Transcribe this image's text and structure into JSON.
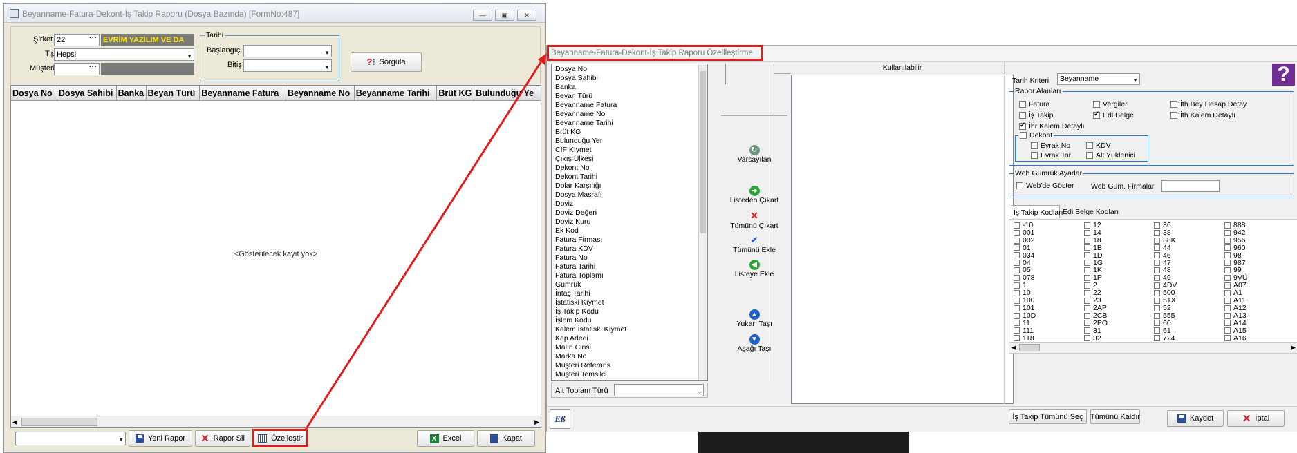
{
  "win1": {
    "title": "Beyanname-Fatura-Dekont-İş Takip Raporu (Dosya Bazında) [FormNo:487]",
    "sirket_label": "Şirket",
    "sirket_value": "22",
    "sirket_name": "EVRİM YAZILIM VE DA",
    "tip_label": "Tip",
    "tip_value": "Hepsi",
    "musteri_label": "Müşteri",
    "musteri_value": "",
    "tarih_group": "Tarihi",
    "baslangic_label": "Başlangıç",
    "bitis_label": "Bitiş",
    "sorgula": "Sorgula",
    "columns": [
      "Dosya No",
      "Dosya Sahibi",
      "Banka",
      "Beyan Türü",
      "Beyanname Fatura",
      "Beyanname No",
      "Beyanname Tarihi",
      "Brüt KG",
      "Bulunduğu Ye"
    ],
    "empty_text": "<Gösterilecek kayıt yok>",
    "bottom_combo": "",
    "yeni_rapor": "Yeni Rapor",
    "rapor_sil": "Rapor Sil",
    "ozellestir": "Özelleştir",
    "excel": "Excel",
    "kapat": "Kapat"
  },
  "win2": {
    "title": "Beyanname-Fatura-Dekont-İş Takip Raporu Özellleştirme",
    "fields": [
      "Dosya No",
      "Dosya Sahibi",
      "Banka",
      "Beyan Türü",
      "Beyanname Fatura",
      "Beyanname No",
      "Beyanname Tarihi",
      "Brüt KG",
      "Bulunduğu Yer",
      "CIF Kıymet",
      "Çıkış Ülkesi",
      "Dekont No",
      "Dekont Tarihi",
      "Dolar Karşılığı",
      "Dosya Masrafı",
      "Doviz",
      "Doviz Değeri",
      "Doviz Kuru",
      "Ek Kod",
      "Fatura Firması",
      "Fatura KDV",
      "Fatura No",
      "Fatura Tarihi",
      "Fatura Toplamı",
      "Gümrük",
      "İntaç Tarihi",
      "İstatiski Kıymet",
      "İş Takip Kodu",
      "İşlem Kodu",
      "Kalem İstatiski Kıymet",
      "Kap Adedi",
      "Malın Cinsi",
      "Marka No",
      "Müşteri Referans",
      "Müşteri Temsilci"
    ],
    "alt_toplam_label": "Alt Toplam Türü",
    "alt_toplam_value": "",
    "kullanilabilir": "Kullanılabilir",
    "varsayilan": "Varsayılan",
    "listeden_cikart": "Listeden Çıkart",
    "tumunu_cikart": "Tümünü Çıkart",
    "tumunu_ekle": "Tümünü Ekle",
    "listeye_ekle": "Listeye Ekle",
    "yukari_tasi": "Yukarı Taşı",
    "asagi_tasi": "Aşağı Taşı",
    "tarih_kriteri_label": "Tarih Kriteri",
    "tarih_kriteri_value": "Beyanname",
    "rapor_alanlari": "Rapor Alanları",
    "opt_fatura": "Fatura",
    "opt_is_takip": "İş Takip",
    "opt_ihr_kalem": "İhr Kalem Detaylı",
    "opt_vergiler": "Vergiler",
    "opt_edi_belge": "Edi Belge",
    "opt_ith_bey": "İth Bey Hesap Detay",
    "opt_ith_kalem": "İth Kalem Detaylı",
    "dekont": "Dekont",
    "opt_evrak_no": "Evrak No",
    "opt_evrak_tar": "Evrak Tar",
    "opt_kdv": "KDV",
    "opt_alt_yuklenici": "Alt Yüklenici",
    "web_group": "Web Gümrük Ayarlar",
    "webde_goster": "Web'de Göster",
    "web_gum_firmalar": "Web Güm. Firmalar",
    "web_gum_value": "",
    "tab_is_takip": "İş Takip Kodları",
    "tab_edi": "Edi Belge Kodları",
    "codes_col1": [
      "-10",
      "001",
      "002",
      "01",
      "034",
      "04",
      "05",
      "078",
      "1",
      "10",
      "100",
      "101",
      "10D",
      "11",
      "111",
      "118"
    ],
    "codes_col2": [
      "12",
      "14",
      "18",
      "1B",
      "1D",
      "1G",
      "1K",
      "1P",
      "2",
      "22",
      "23",
      "2AP",
      "2CB",
      "2PO",
      "31",
      "32"
    ],
    "codes_col3": [
      "36",
      "38",
      "38K",
      "44",
      "46",
      "47",
      "48",
      "49",
      "4DV",
      "500",
      "51X",
      "52",
      "555",
      "60",
      "61",
      "724"
    ],
    "codes_col4": [
      "888",
      "942",
      "956",
      "960",
      "98",
      "987",
      "99",
      "9VÜ",
      "A07",
      "A1",
      "A11",
      "A12",
      "A13",
      "A14",
      "A15",
      "A16"
    ],
    "is_takip_tumunu_sec": "İş Takip Tümünü Seç",
    "tumunu_kaldir": "Tümünü Kaldır",
    "kaydet": "Kaydet",
    "iptal": "İptal"
  },
  "colors": {
    "highlight": "#e31b1b",
    "sirket_name_bg": "#7a7a7a",
    "sirket_name_fg": "#ffe400",
    "purple": "#6e2d91"
  }
}
